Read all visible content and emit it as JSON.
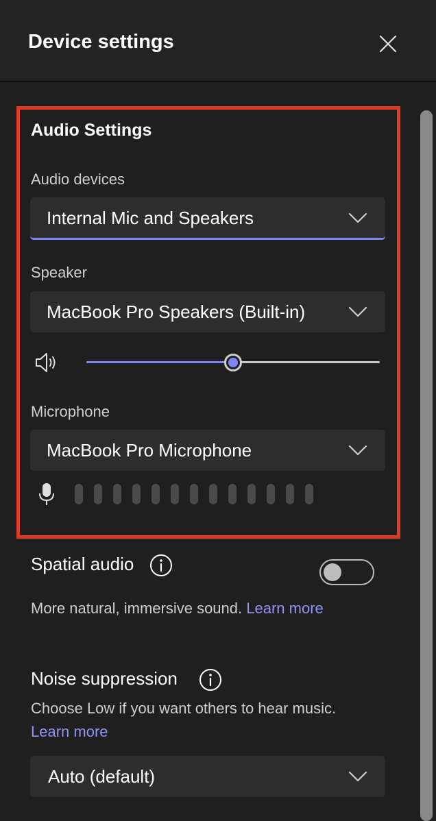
{
  "header": {
    "title": "Device settings",
    "close_icon": "close-icon"
  },
  "audio_settings": {
    "title": "Audio Settings",
    "audio_devices": {
      "label": "Audio devices",
      "value": "Internal Mic and Speakers"
    },
    "speaker": {
      "label": "Speaker",
      "value": "MacBook Pro Speakers (Built-in)",
      "volume_icon": "speaker-volume-icon",
      "volume_fraction": 0.5
    },
    "microphone": {
      "label": "Microphone",
      "value": "MacBook Pro Microphone",
      "mic_icon": "microphone-icon",
      "level_bars": 13,
      "level_active": 0
    }
  },
  "spatial_audio": {
    "title": "Spatial audio",
    "enabled": false,
    "description": "More natural, immersive sound.",
    "link": "Learn more"
  },
  "noise_suppression": {
    "title": "Noise suppression",
    "description": "Choose Low if you want others to hear music.",
    "link": "Learn more",
    "value": "Auto (default)"
  },
  "colors": {
    "background": "#1f1f1f",
    "accent": "#7f85f5",
    "highlight_border": "#e03a24",
    "link": "#8f94f7"
  }
}
